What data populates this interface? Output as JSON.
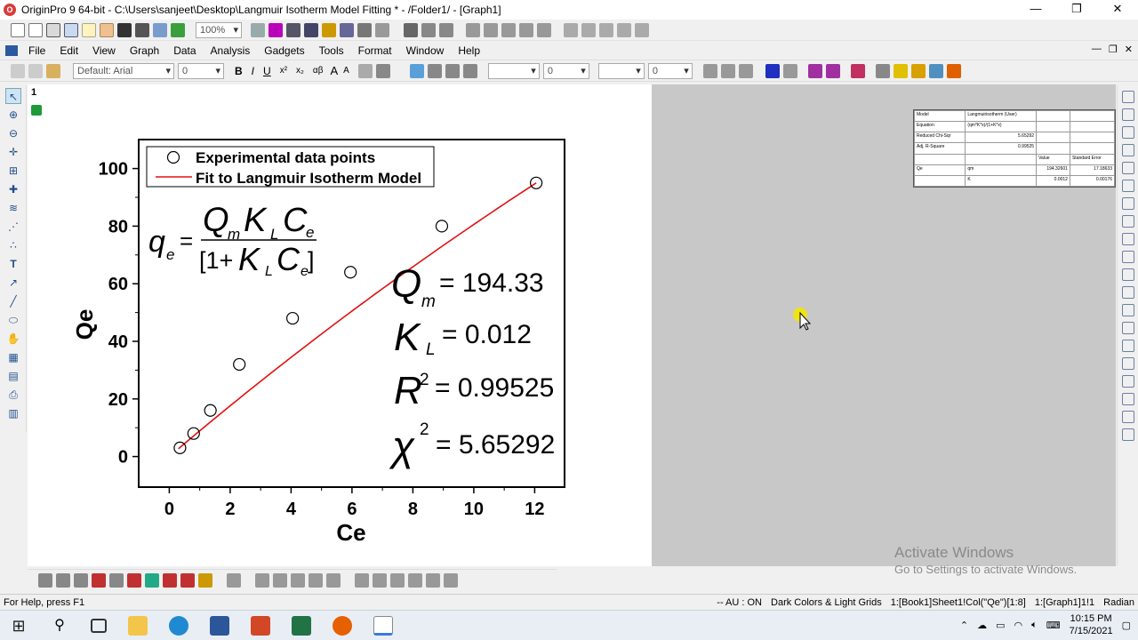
{
  "window": {
    "title": "OriginPro 9 64-bit - C:\\Users\\sanjeet\\Desktop\\Langmuir Isotherm Model Fitting * - /Folder1/ - [Graph1]",
    "minimize": "—",
    "restore": "❐",
    "close": "✕"
  },
  "toolbar": {
    "zoom": "100%"
  },
  "menu": [
    "File",
    "Edit",
    "View",
    "Graph",
    "Data",
    "Analysis",
    "Gadgets",
    "Tools",
    "Format",
    "Window",
    "Help"
  ],
  "format_toolbar": {
    "font": "Default: Arial",
    "size": "0",
    "line_width": "0",
    "border_width": "0"
  },
  "graph": {
    "layer": "1",
    "legend": [
      "Experimental data points",
      "Fit to Langmuir Isotherm Model"
    ],
    "equation": {
      "lhs": "q",
      "lhs_sub": "e",
      "eq": "=",
      "num_Q": "Q",
      "num_Q_sub": "m",
      "num_K": "K",
      "num_K_sub": "L",
      "num_C": "C",
      "num_C_sub": "e",
      "den_open": "[1+",
      "den_K": "K",
      "den_K_sub": "L",
      "den_C": "C",
      "den_C_sub": "e",
      "den_close": "]"
    },
    "params": [
      {
        "sym": "Q",
        "sub": "m",
        "sup": "",
        "val": "= 194.33"
      },
      {
        "sym": "K",
        "sub": "L",
        "sup": "",
        "val": "= 0.012"
      },
      {
        "sym": "R",
        "sub": "",
        "sup": "2",
        "val": "= 0.99525"
      },
      {
        "sym": "χ",
        "sub": "",
        "sup": "2",
        "val": "= 5.65292"
      }
    ],
    "colors": {
      "fit": "#e01010",
      "points": "#000000"
    }
  },
  "chart_data": {
    "type": "scatter",
    "xlabel": "Ce",
    "ylabel": "Qe",
    "xlim": [
      -1,
      13
    ],
    "ylim": [
      -10,
      110
    ],
    "xticks": [
      0,
      2,
      4,
      6,
      8,
      10,
      12
    ],
    "yticks": [
      0,
      20,
      40,
      60,
      80,
      100
    ],
    "series": [
      {
        "name": "Experimental data points",
        "x": [
          0.35,
          0.8,
          1.35,
          2.3,
          4.05,
          5.95,
          8.95,
          12.05
        ],
        "y": [
          3,
          8,
          16,
          32,
          48,
          64,
          80,
          95
        ]
      },
      {
        "name": "Fit to Langmuir Isotherm Model",
        "model": "langmuir",
        "Qm": 194.33,
        "KL": 0.012,
        "x_range": [
          0.3,
          12.05
        ]
      }
    ]
  },
  "result_table": {
    "rows": [
      [
        "Model",
        "Langmuirisotherm (User)",
        "",
        ""
      ],
      [
        "Equation",
        "(qm*K*x)/(1+K*x)",
        "",
        ""
      ],
      [
        "Reduced Chi-Sqr",
        "5.65292",
        "",
        ""
      ],
      [
        "Adj. R-Square",
        "0.99525",
        "",
        ""
      ],
      [
        "",
        "",
        "Value",
        "Standard Error"
      ],
      [
        "Qe",
        "qm",
        "194.32601",
        "17.18633"
      ],
      [
        "",
        "K",
        "0.0012",
        "0.00176"
      ]
    ]
  },
  "watermark": {
    "line1": "Activate Windows",
    "line2": "Go to Settings to activate Windows."
  },
  "status": {
    "left": "For Help, press F1",
    "right": [
      "-- AU : ON",
      "Dark Colors & Light Grids",
      "1:[Book1]Sheet1!Col(\"Qe\")[1:8]",
      "1:[Graph1]1!1",
      "Radian"
    ]
  },
  "clock": {
    "time": "10:15 PM",
    "date": "7/15/2021"
  }
}
